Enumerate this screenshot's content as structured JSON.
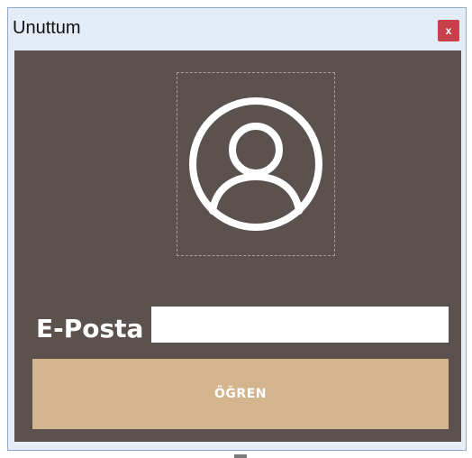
{
  "window": {
    "title": "Unuttum",
    "close_label": "x"
  },
  "form": {
    "email_label": "E-Posta :",
    "email_value": "",
    "email_placeholder": "",
    "submit_label": "ÖĞREN"
  },
  "icons": {
    "avatar": "user-avatar-icon",
    "close": "close-icon"
  },
  "colors": {
    "background": "#5b514e",
    "button": "#d4b48c",
    "close_button": "#c7404a",
    "titlebar": "#e4ecf7"
  }
}
